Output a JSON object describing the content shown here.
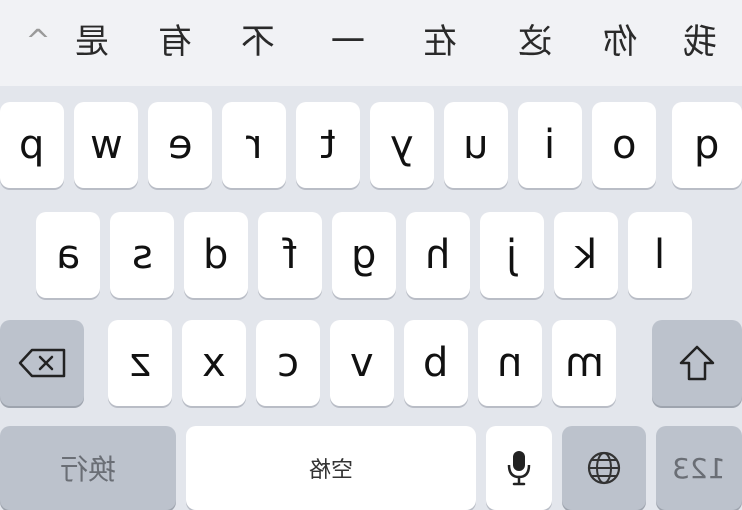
{
  "candidates": {
    "chevron": "^",
    "items": [
      "我",
      "你",
      "这",
      "在",
      "一",
      "不",
      "有",
      "是"
    ]
  },
  "rows": {
    "row1": [
      "p",
      "w",
      "e",
      "r",
      "t",
      "y",
      "u",
      "i",
      "o",
      "q"
    ],
    "row2": [
      "a",
      "s",
      "d",
      "f",
      "g",
      "h",
      "j",
      "k",
      "l"
    ],
    "row3": [
      "z",
      "x",
      "c",
      "v",
      "b",
      "n",
      "m"
    ]
  },
  "bottom": {
    "numbers_label": "123",
    "space_label": "空格",
    "return_label": "换行"
  },
  "icons": {
    "shift": "shift-icon",
    "delete": "delete-icon",
    "globe": "globe-icon",
    "mic": "microphone-icon"
  },
  "colors": {
    "key_bg": "#ffffff",
    "function_key_bg": "#bcc2cc",
    "keyboard_bg": "#e3e6ec"
  }
}
